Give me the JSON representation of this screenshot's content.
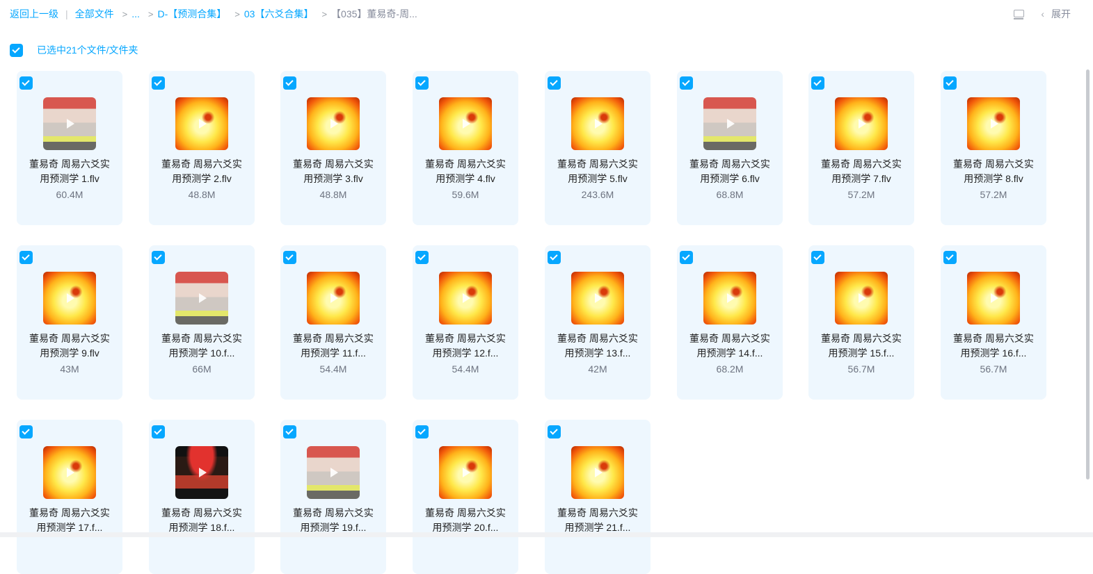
{
  "breadcrumb": {
    "back": "返回上一级",
    "all_files": "全部文件",
    "ellipsis": "...",
    "level1": "D-【预测合集】",
    "level2": "03【六爻合集】",
    "current": "【035】董易奇-周...",
    "sep": ">",
    "divider": "|"
  },
  "toolbar": {
    "expand_label": "展开",
    "view_icon": "list-view-icon",
    "collapse_icon": "chevron-left-icon"
  },
  "selection": {
    "text": "已选中21个文件/文件夹",
    "checked": true
  },
  "colors": {
    "accent": "#06a7ff",
    "card_bg": "#eef7fe"
  },
  "files": [
    {
      "line1": "董易奇 周易六爻实",
      "line2": "用预测学 1.flv",
      "size": "60.4M",
      "thumb": "crowd"
    },
    {
      "line1": "董易奇 周易六爻实",
      "line2": "用预测学 2.flv",
      "size": "48.8M",
      "thumb": "fire"
    },
    {
      "line1": "董易奇 周易六爻实",
      "line2": "用预测学 3.flv",
      "size": "48.8M",
      "thumb": "fire"
    },
    {
      "line1": "董易奇 周易六爻实",
      "line2": "用预测学 4.flv",
      "size": "59.6M",
      "thumb": "fire"
    },
    {
      "line1": "董易奇 周易六爻实",
      "line2": "用预测学 5.flv",
      "size": "243.6M",
      "thumb": "fire"
    },
    {
      "line1": "董易奇 周易六爻实",
      "line2": "用预测学 6.flv",
      "size": "68.8M",
      "thumb": "crowd"
    },
    {
      "line1": "董易奇 周易六爻实",
      "line2": "用预测学 7.flv",
      "size": "57.2M",
      "thumb": "fire"
    },
    {
      "line1": "董易奇 周易六爻实",
      "line2": "用预测学 8.flv",
      "size": "57.2M",
      "thumb": "fire"
    },
    {
      "line1": "董易奇 周易六爻实",
      "line2": "用预测学 9.flv",
      "size": "43M",
      "thumb": "fire"
    },
    {
      "line1": "董易奇 周易六爻实",
      "line2": "用预测学 10.f...",
      "size": "66M",
      "thumb": "crowd"
    },
    {
      "line1": "董易奇 周易六爻实",
      "line2": "用预测学 11.f...",
      "size": "54.4M",
      "thumb": "fire"
    },
    {
      "line1": "董易奇 周易六爻实",
      "line2": "用预测学 12.f...",
      "size": "54.4M",
      "thumb": "fire"
    },
    {
      "line1": "董易奇 周易六爻实",
      "line2": "用预测学 13.f...",
      "size": "42M",
      "thumb": "fire"
    },
    {
      "line1": "董易奇 周易六爻实",
      "line2": "用预测学 14.f...",
      "size": "68.2M",
      "thumb": "fire"
    },
    {
      "line1": "董易奇 周易六爻实",
      "line2": "用预测学 15.f...",
      "size": "56.7M",
      "thumb": "fire"
    },
    {
      "line1": "董易奇 周易六爻实",
      "line2": "用预测学 16.f...",
      "size": "56.7M",
      "thumb": "fire"
    },
    {
      "line1": "董易奇 周易六爻实",
      "line2": "用预测学 17.f...",
      "size": "",
      "thumb": "fire"
    },
    {
      "line1": "董易奇 周易六爻实",
      "line2": "用预测学 18.f...",
      "size": "",
      "thumb": "dark"
    },
    {
      "line1": "董易奇 周易六爻实",
      "line2": "用预测学 19.f...",
      "size": "",
      "thumb": "crowd"
    },
    {
      "line1": "董易奇 周易六爻实",
      "line2": "用预测学 20.f...",
      "size": "",
      "thumb": "fire"
    },
    {
      "line1": "董易奇 周易六爻实",
      "line2": "用预测学 21.f...",
      "size": "",
      "thumb": "fire"
    }
  ]
}
